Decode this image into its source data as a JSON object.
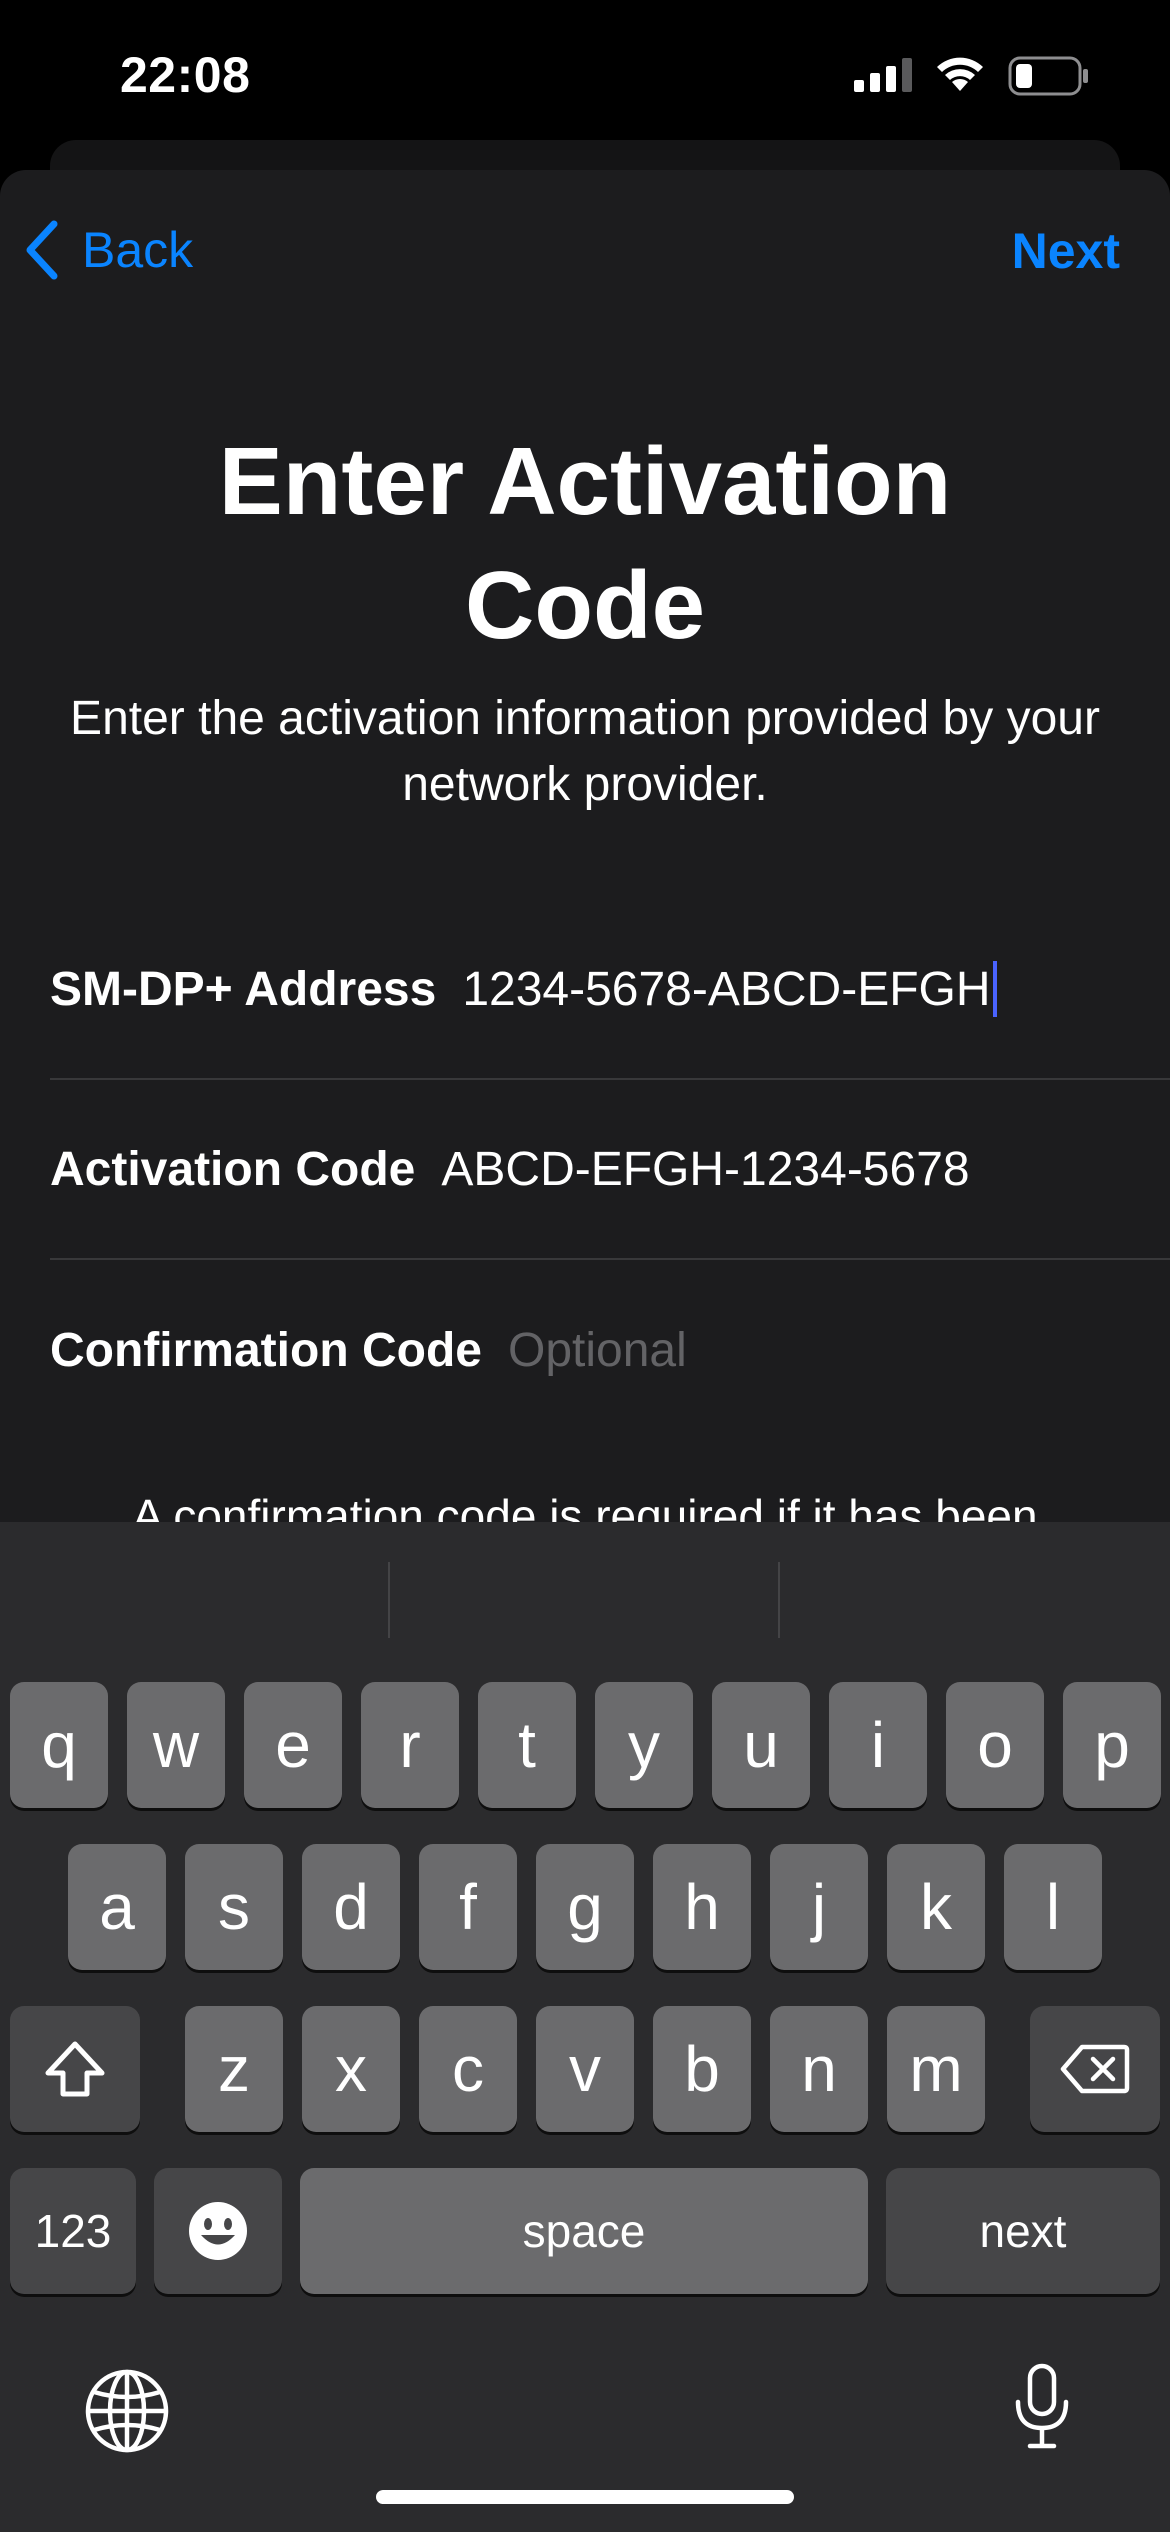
{
  "status": {
    "time": "22:08"
  },
  "nav": {
    "back_label": "Back",
    "next_label": "Next"
  },
  "page": {
    "title_line1": "Enter Activation",
    "title_line2": "Code",
    "subtitle": "Enter the activation information provided by your network provider."
  },
  "form": {
    "smdp": {
      "label": "SM-DP+ Address",
      "value": "1234-5678-ABCD-EFGH"
    },
    "activation": {
      "label": "Activation Code",
      "value": "ABCD-EFGH-1234-5678"
    },
    "confirmation": {
      "label": "Confirmation Code",
      "placeholder": "Optional"
    }
  },
  "footnote": "A confirmation code is required if it has been",
  "keyboard": {
    "row1": [
      "q",
      "w",
      "e",
      "r",
      "t",
      "y",
      "u",
      "i",
      "o",
      "p"
    ],
    "row2": [
      "a",
      "s",
      "d",
      "f",
      "g",
      "h",
      "j",
      "k",
      "l"
    ],
    "row3": [
      "z",
      "x",
      "c",
      "v",
      "b",
      "n",
      "m"
    ],
    "numbers_label": "123",
    "space_label": "space",
    "return_label": "next"
  },
  "colors": {
    "accent": "#0a84ff",
    "sheet_bg": "#1c1c1e",
    "keyboard_bg": "#2b2b2d",
    "key_bg": "#6b6b6d",
    "key_dark_bg": "#464648",
    "caret": "#4a63ff"
  },
  "icons": {
    "back": "chevron-left-icon",
    "shift": "shift-arrow-icon",
    "delete": "delete-backspace-icon",
    "emoji": "emoji-face-icon",
    "globe": "globe-icon",
    "mic": "microphone-icon"
  }
}
